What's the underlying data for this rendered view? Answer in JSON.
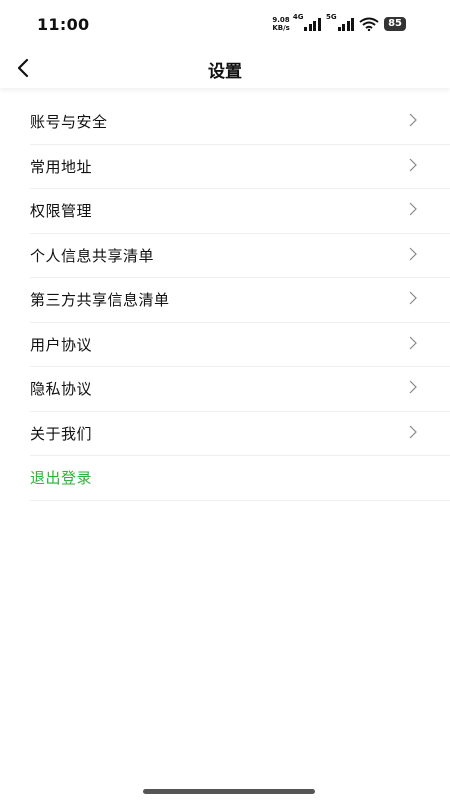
{
  "status_bar": {
    "time": "11:00",
    "net_speed_value": "9.08",
    "net_speed_unit": "KB/s",
    "network_tag_1": "4G",
    "network_tag_2": "5G",
    "battery": "85"
  },
  "header": {
    "title": "设置"
  },
  "menu": {
    "items": [
      {
        "label": "账号与安全"
      },
      {
        "label": "常用地址"
      },
      {
        "label": "权限管理"
      },
      {
        "label": "个人信息共享清单"
      },
      {
        "label": "第三方共享信息清单"
      },
      {
        "label": "用户协议"
      },
      {
        "label": "隐私协议"
      },
      {
        "label": "关于我们"
      }
    ],
    "logout_label": "退出登录"
  },
  "colors": {
    "logout": "#2bb53a"
  }
}
